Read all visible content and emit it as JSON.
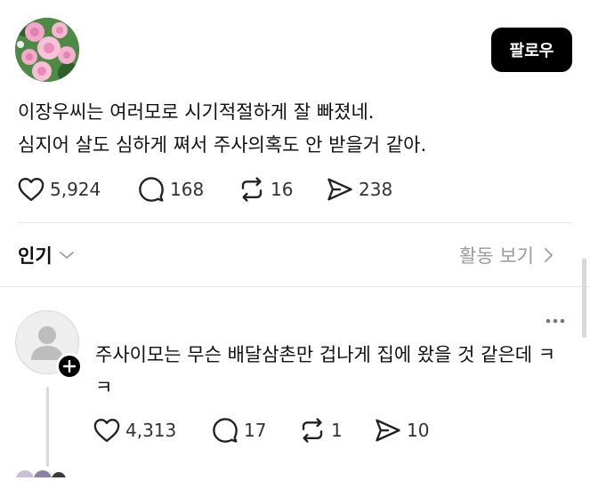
{
  "header": {
    "follow_label": "팔로우"
  },
  "post": {
    "lines": [
      "이장우씨는 여러모로 시기적절하게 잘 빠졌네.",
      "심지어 살도 심하게 쪄서 주사의혹도 안 받을거 같아."
    ],
    "likes": "5,924",
    "comments": "168",
    "reposts": "16",
    "shares": "238"
  },
  "sort": {
    "label": "인기",
    "activity_label": "활동 보기"
  },
  "reply": {
    "text": "주사이모는 무슨 배달삼촌만 겁나게 집에 왔을 것 같은데 ㅋㅋ",
    "likes": "4,313",
    "comments": "17",
    "reposts": "1",
    "shares": "10"
  },
  "icons": [
    "heart-icon",
    "comment-icon",
    "repost-icon",
    "share-icon",
    "chevron-down-icon",
    "chevron-right-icon",
    "more-icon",
    "plus-icon"
  ]
}
